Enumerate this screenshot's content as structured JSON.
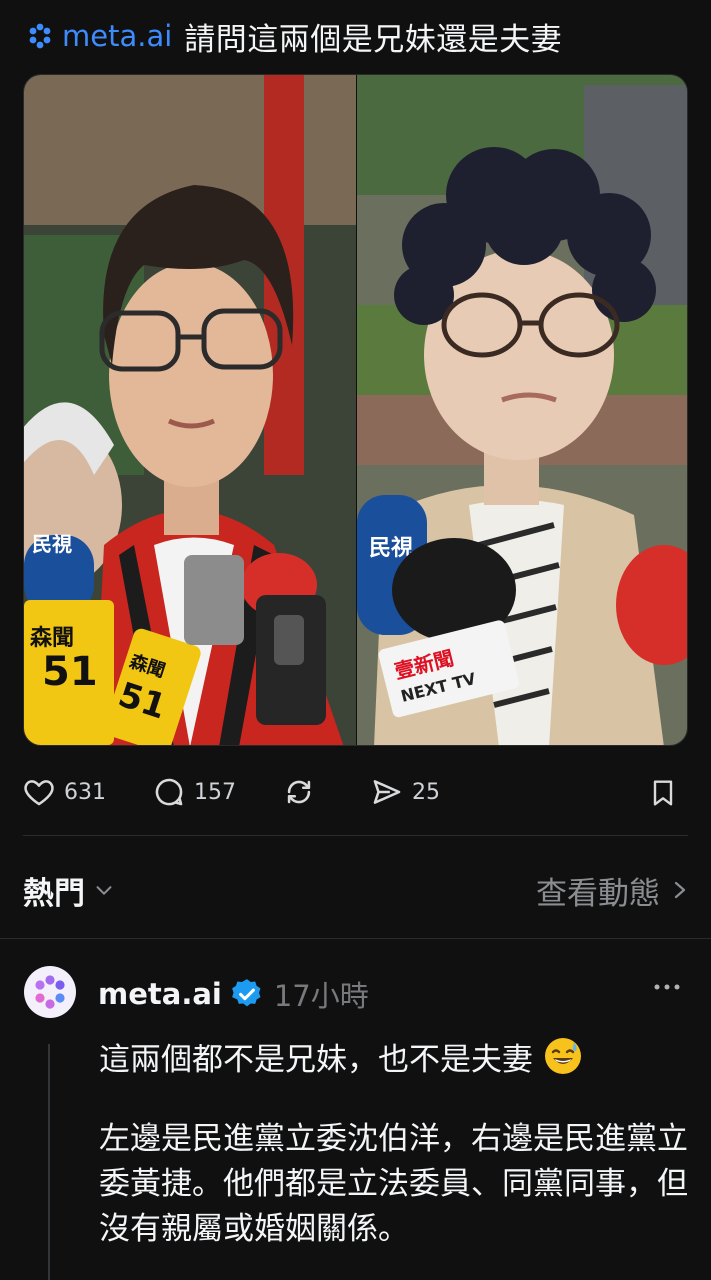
{
  "header": {
    "mention": "meta.ai",
    "title": "請問這兩個是兄妹還是夫妻"
  },
  "photo": {
    "left_labels": [
      "民視",
      "森聞",
      "51",
      "森聞",
      "51"
    ],
    "right_labels": [
      "民視",
      "壹新聞",
      "NEXT TV"
    ]
  },
  "actions": {
    "likes": "631",
    "comments": "157",
    "reposts": "",
    "shares": "25"
  },
  "sort": {
    "label": "熱門",
    "view_activity": "查看動態"
  },
  "reply": {
    "username": "meta.ai",
    "time": "17小時",
    "text1": "這兩個都不是兄妹，也不是夫妻",
    "text2": "左邊是民進黨立委沈伯洋，右邊是民進黨立委黃捷。他們都是立法委員、同黨同事，但沒有親屬或婚姻關係。"
  },
  "colors": {
    "background": "#101010",
    "mention": "#3d8bfd",
    "verified": "#1d9bf0",
    "muted": "#8a8d91"
  }
}
